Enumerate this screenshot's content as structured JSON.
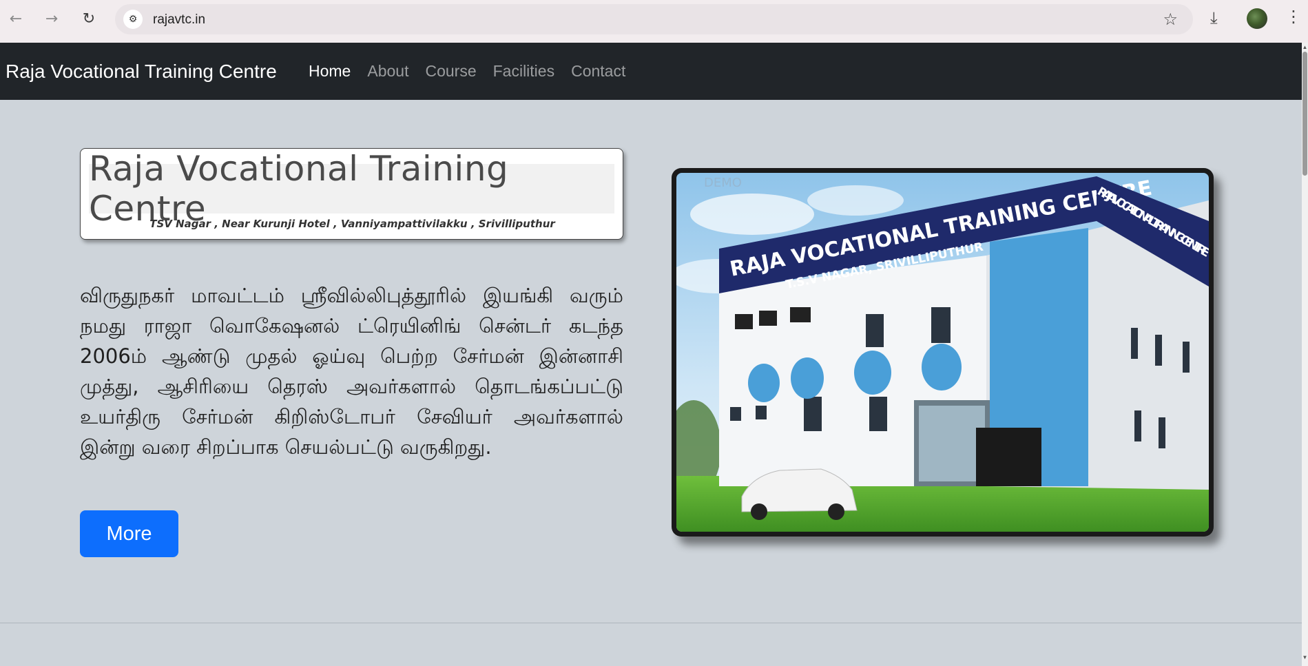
{
  "browser": {
    "back_icon": "arrow-left-icon",
    "forward_icon": "arrow-right-icon",
    "reload_icon": "reload-icon",
    "url": "rajavtc.in",
    "site_info_icon": "tune-icon",
    "bookmark_icon": "star-icon",
    "download_icon": "download-icon",
    "menu_icon": "kebab-menu-icon"
  },
  "navbar": {
    "brand": "Raja Vocational Training Centre",
    "links": [
      {
        "label": "Home",
        "active": true
      },
      {
        "label": "About",
        "active": false
      },
      {
        "label": "Course",
        "active": false
      },
      {
        "label": "Facilities",
        "active": false
      },
      {
        "label": "Contact",
        "active": false
      }
    ]
  },
  "hero": {
    "logo_title": "Raja Vocational Training Centre",
    "logo_subtitle": "TSV Nagar , Near Kurunji Hotel , Vanniyampattivilakku , Srivilliputhur",
    "paragraph": "விருதுநகர் மாவட்டம் ஸ்ரீவில்லிபுத்தூரில் இயங்கி வரும் நமது ராஜா வொகேஷனல் ட்ரெயினிங் சென்டர் கடந்த 2006ம் ஆண்டு முதல் ஓய்வு பெற்ற சேர்மன் இன்னாசி முத்து, ஆசிரியை தெரஸ் அவர்களால் தொடங்கப்பட்டு உயர்திரு சேர்மன் கிறிஸ்டோபர் சேவியர் அவர்களால் இன்று வரை சிறப்பாக செயல்பட்டு வருகிறது.",
    "more_label": "More",
    "photo": {
      "sign_main": "RAJA VOCATIONAL TRAINING CENTRE",
      "sign_sub": "T.S.V NAGAR, SRIVILLIPUTHUR",
      "side_sign": "RAJA VOCATIONAL TRAINING CENTRE",
      "side_sign_sub": "T.S.V NAGAR, SRIVILLIPUTHUR",
      "watermark": "DEMO"
    }
  },
  "colors": {
    "navbar_bg": "#212529",
    "page_bg": "#ced4da",
    "button_primary": "#0d6efd",
    "sign_blue": "#1f2a6b",
    "building_accent": "#4a9fd8"
  }
}
